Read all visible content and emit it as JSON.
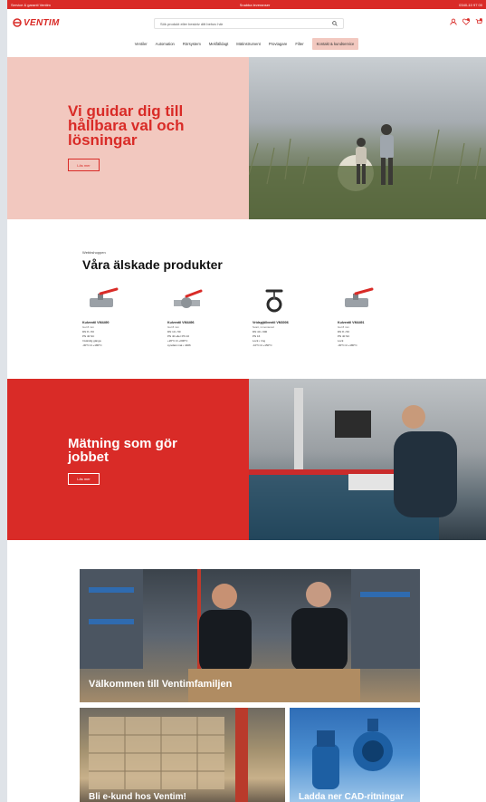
{
  "topbar": {
    "left": "Service & garanti Ventim",
    "center": "Snabba leveranser",
    "right": "0340-10 97 00"
  },
  "brand": {
    "name": "VENTIM",
    "accent": "#d92b27"
  },
  "search": {
    "placeholder": "Sök produkt eller beskriv ditt behov här",
    "icon": "search-icon"
  },
  "header_icons": [
    "user-icon",
    "wishlist-icon",
    "cart-icon"
  ],
  "nav": {
    "items": [
      "Ventiler",
      "Automation",
      "Rörsystem",
      "Mekfälldagt",
      "Mätinstrument",
      "Provtagare",
      "Filter",
      "Kontakt & kundservice"
    ]
  },
  "hero": {
    "title": "Vi guidar dig till hållbara val och lösningar",
    "button": "Läs mer"
  },
  "products": {
    "kicker": "Webbshoppen",
    "title": "Våra älskade produkter",
    "items": [
      {
        "name": "Kulventil VM4490",
        "sub": "Gul 8 mm",
        "specs": [
          "DN 8 • 50",
          "PN 40 SC",
          "Invändig gänga",
          "-30°C til +180°C"
        ]
      },
      {
        "name": "Kulventil VM4496",
        "sub": "Gul 8 mm",
        "specs": [
          "DN 10 • 50",
          "PN 40 eller PN 10",
          "+20°C til +300°C",
          "syrefast mat • 4406"
        ]
      },
      {
        "name": "Vridspjällventil VM3006",
        "sub": "Svart, inmonterad",
        "specs": [
          "DN 40 • 600",
          "PN 16",
          "Lock • ring",
          "-10°C til +150°C"
        ]
      },
      {
        "name": "Kulventil VM4491",
        "sub": "Gul 8 mm",
        "specs": [
          "DN 8 • 50",
          "PN 40 SC",
          "Lock",
          "-30°C til +180°C"
        ]
      }
    ]
  },
  "measure": {
    "title": "Mätning som gör jobbet",
    "button": "Läs mer"
  },
  "team": {
    "label": "Välkommen till Ventimfamiljen"
  },
  "tiles": [
    {
      "label": "Bli e-kund hos Ventim!"
    },
    {
      "label": "Ladda ner CAD-ritningar"
    }
  ]
}
